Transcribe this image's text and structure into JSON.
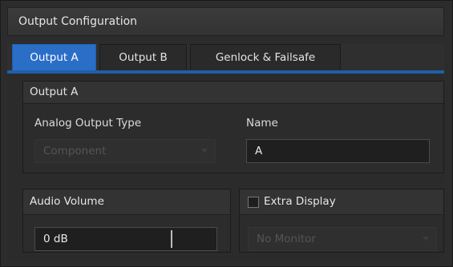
{
  "window": {
    "title": "Output Configuration"
  },
  "tabs": [
    {
      "label": "Output A",
      "active": true
    },
    {
      "label": "Output B",
      "active": false
    },
    {
      "label": "Genlock & Failsafe",
      "active": false
    }
  ],
  "output_group": {
    "header": "Output A",
    "analog_label": "Analog Output Type",
    "analog_value": "Component",
    "name_label": "Name",
    "name_value": "A"
  },
  "audio_group": {
    "header": "Audio Volume",
    "value": "0 dB"
  },
  "extra_display_group": {
    "header": "Extra Display",
    "checked": false,
    "monitor_value": "No Monitor"
  },
  "colors": {
    "accent": "#2b6ec8",
    "tab_underline": "#1f5fa8",
    "background": "#2c2c2c"
  },
  "icons": {
    "dropdown": "chevron-down-icon",
    "checkbox": "checkbox-unchecked-icon"
  }
}
